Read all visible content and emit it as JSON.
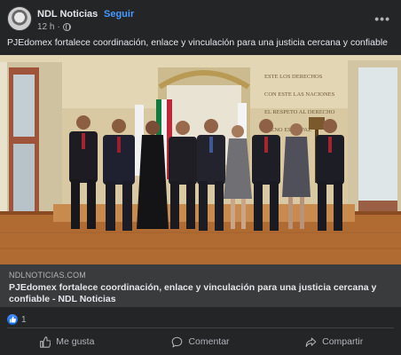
{
  "post": {
    "page_name": "NDL Noticias",
    "separator": "·",
    "follow_label": "Seguir",
    "time": "12 h",
    "time_separator": "·",
    "caption": "PJEdomex fortalece coordinación, enlace y vinculación  para una justicia cercana y confiable",
    "more_icon": "more-horizontal-icon"
  },
  "photo": {
    "wall_inscription": [
      "ESTE LOS DERECHOS",
      "CON ESTE LAS NACIONES",
      "EL RESPETO AL DERECHO",
      "AJENO ES LA PAZ"
    ]
  },
  "link_preview": {
    "domain": "NDLNOTICIAS.COM",
    "title": "PJEdomex fortalece coordinación, enlace y vinculación para una justicia cercana y confiable - NDL Noticias"
  },
  "reactions": {
    "icon": "like-reaction-icon",
    "count": "1"
  },
  "actions": {
    "like_label": "Me gusta",
    "comment_label": "Comentar",
    "share_label": "Compartir"
  },
  "colors": {
    "background": "#242526",
    "link_preview_bg": "#3a3b3c",
    "accent": "#4599ff",
    "text_primary": "#e4e6eb",
    "text_secondary": "#b0b3b8"
  }
}
